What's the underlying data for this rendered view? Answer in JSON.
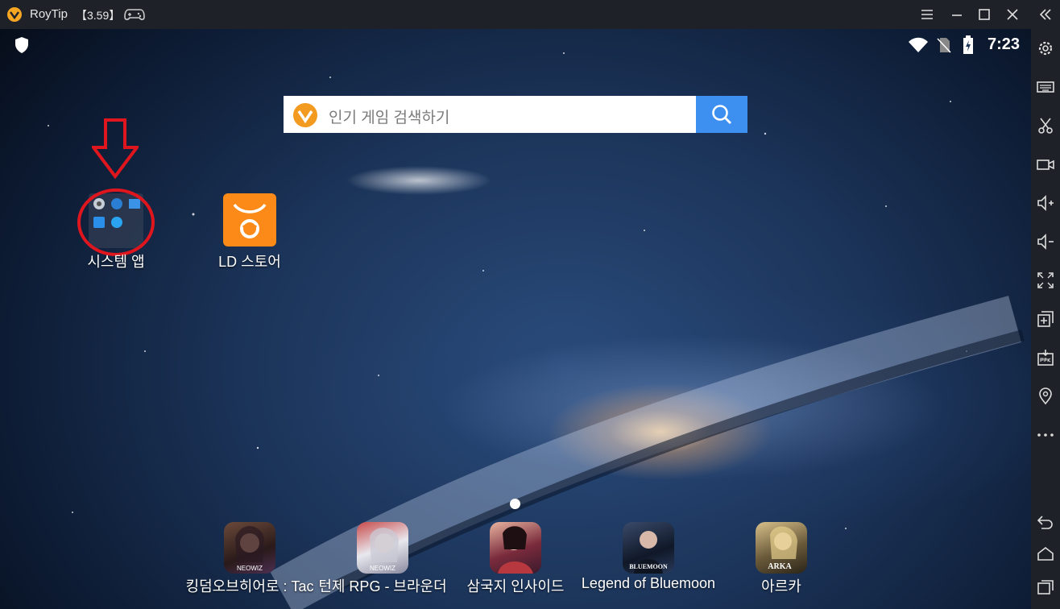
{
  "titlebar": {
    "app_name": "RoyTip",
    "version": "【3.59】"
  },
  "status_bar": {
    "time": "7:23"
  },
  "search": {
    "placeholder": "인기 게임 검색하기"
  },
  "desktop": [
    {
      "label": "시스템 앱"
    },
    {
      "label": "LD 스토어"
    }
  ],
  "dock": [
    {
      "label": "킹덤오브히어로 : Tac",
      "badge": "NEOWIZ"
    },
    {
      "label": "턴제 RPG - 브라운더",
      "badge": "NEOWIZ"
    },
    {
      "label": "삼국지 인사이드"
    },
    {
      "label": "Legend of Bluemoon",
      "badge": "BLUEMOON"
    },
    {
      "label": "아르카",
      "badge": "ARKA"
    }
  ],
  "colors": {
    "titlebar": "#1e2127",
    "search_button": "#3d8ff0",
    "store": "#fb8a18",
    "annotation": "#e0161e"
  }
}
